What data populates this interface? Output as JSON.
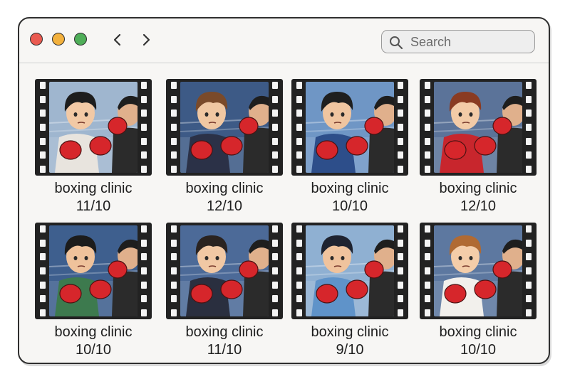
{
  "toolbar": {
    "search_placeholder": "Search",
    "back_icon": "chevron-left-icon",
    "forward_icon": "chevron-right-icon"
  },
  "colors": {
    "close": "#ea5a50",
    "minimize": "#f3b13d",
    "maximize": "#4fae58",
    "glove": "#d6262b"
  },
  "videos": [
    {
      "title": "boxing clinic",
      "date": "11/10",
      "bg": "#9fb6cf",
      "hair": "#1d1d1d",
      "shirt": "#e8e4de",
      "skin": "#f2c9a5"
    },
    {
      "title": "boxing clinic",
      "date": "12/10",
      "bg": "#3d5a86",
      "hair": "#7a4a2a",
      "shirt": "#2b3147",
      "skin": "#f0c7a2"
    },
    {
      "title": "boxing clinic",
      "date": "10/10",
      "bg": "#6f96c5",
      "hair": "#1f1f1f",
      "shirt": "#2d4e8a",
      "skin": "#f0c5a0"
    },
    {
      "title": "boxing clinic",
      "date": "12/10",
      "bg": "#5b7399",
      "hair": "#8a3b22",
      "shirt": "#c8262d",
      "skin": "#f3cba7"
    },
    {
      "title": "boxing clinic",
      "date": "10/10",
      "bg": "#3e5f8e",
      "hair": "#1c1c1c",
      "shirt": "#3d7a4e",
      "skin": "#efc29b"
    },
    {
      "title": "boxing clinic",
      "date": "11/10",
      "bg": "#4c6a98",
      "hair": "#2a2320",
      "shirt": "#2a2f3f",
      "skin": "#f1c8a4"
    },
    {
      "title": "boxing clinic",
      "date": "9/10",
      "bg": "#8fb0d2",
      "hair": "#1f2330",
      "shirt": "#5f93c9",
      "skin": "#f0c39d"
    },
    {
      "title": "boxing clinic",
      "date": "10/10",
      "bg": "#5d78a0",
      "hair": "#b06a33",
      "shirt": "#f2f0ec",
      "skin": "#f4cda9"
    }
  ]
}
